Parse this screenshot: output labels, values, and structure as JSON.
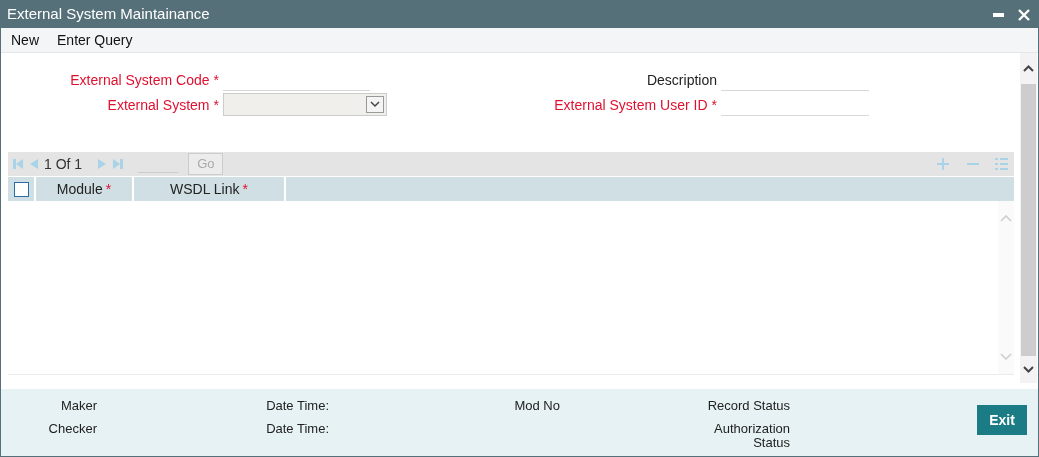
{
  "window": {
    "title": "External System Maintainance"
  },
  "menu": [
    "New",
    "Enter Query"
  ],
  "form": {
    "left": [
      {
        "label": "External System Code",
        "required": true,
        "mark": "*",
        "kind": "text"
      },
      {
        "label": "External System",
        "required": true,
        "mark": "*",
        "kind": "select"
      }
    ],
    "right": [
      {
        "label": "Description",
        "required": false,
        "kind": "text"
      },
      {
        "label": "External System User ID",
        "required": true,
        "mark": "*",
        "kind": "text"
      }
    ]
  },
  "grid": {
    "pager": "1 Of 1",
    "go_button": "Go",
    "select_all": {
      "checked": false
    },
    "columns": [
      {
        "label": "Module",
        "required": true,
        "mark": "*"
      },
      {
        "label": "WSDL Link",
        "required": true,
        "mark": "*"
      }
    ]
  },
  "footer": {
    "columns": [
      [
        "Maker",
        "Checker"
      ],
      [
        "Date Time:",
        "Date Time:"
      ],
      [
        "Mod No"
      ],
      [
        "Record Status",
        "Authorization Status"
      ]
    ],
    "exit_button": "Exit"
  }
}
